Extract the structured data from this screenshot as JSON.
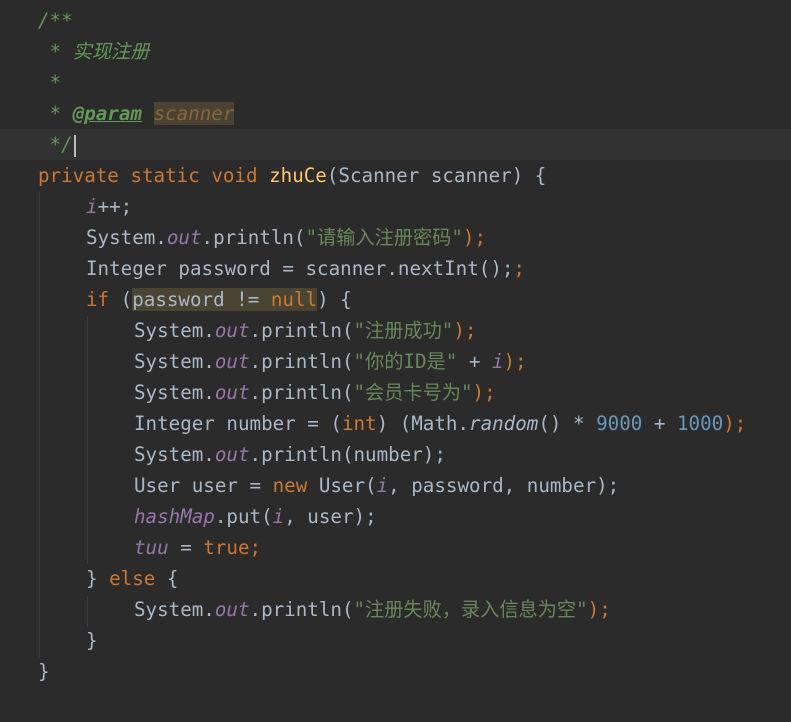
{
  "editor": {
    "language": "java",
    "theme_bg": "#2b2b2b",
    "colors": {
      "keyword": "#cc7832",
      "method_decl": "#ffc66d",
      "string": "#6a8759",
      "number": "#6897bb",
      "field": "#9876aa",
      "doc_comment": "#629755",
      "default": "#a9b7c6"
    },
    "doc": {
      "open": "/**",
      "desc": " * 实现注册",
      "blank": " *",
      "param_star": " * ",
      "param_tag": "@param",
      "param_name": "scanner",
      "close": " */"
    },
    "method": {
      "mod_private": "private",
      "mod_static": "static",
      "ret_void": "void",
      "name": "zhuCe",
      "params": "(Scanner scanner) {"
    },
    "body": {
      "l1_field": "i",
      "l1_rest": "++;",
      "l2_sys": "System.",
      "l2_out": "out",
      "l2_print": ".println(",
      "l2_str": "\"请输入注册密码\"",
      "l2_end": ");",
      "l3_text": "Integer password = scanner.nextInt();",
      "l4_if": "if",
      "l4_open": " (",
      "l4_var": "password != ",
      "l4_null": "null",
      "l4_close": ") {",
      "l5_str": "\"注册成功\"",
      "l6_str": "\"你的ID是\"",
      "l6_plus": " + ",
      "l6_var": "i",
      "l7_str": "\"会员卡号为\"",
      "l8_a": "Integer number = (",
      "l8_int": "int",
      "l8_b": ") (Math.",
      "l8_random": "random",
      "l8_c": "() * ",
      "l8_n1": "9000",
      "l8_d": " + ",
      "l8_n2": "1000",
      "l8_e": ");",
      "l9_text": ".println(number);",
      "l10_a": "User user = ",
      "l10_new": "new",
      "l10_b": " User(",
      "l10_i": "i",
      "l10_c": ", password, number);",
      "l11_map": "hashMap",
      "l11_a": ".put(",
      "l11_i": "i",
      "l11_b": ", user);",
      "l12_tuu": "tuu",
      "l12_eq": " = ",
      "l12_true": "true",
      "l12_semi": ";",
      "l13_a": "} ",
      "l13_else": "else",
      "l13_b": " {",
      "l14_str": "\"注册失败，录入信息为空\"",
      "l15": "}",
      "l16": "}"
    }
  }
}
